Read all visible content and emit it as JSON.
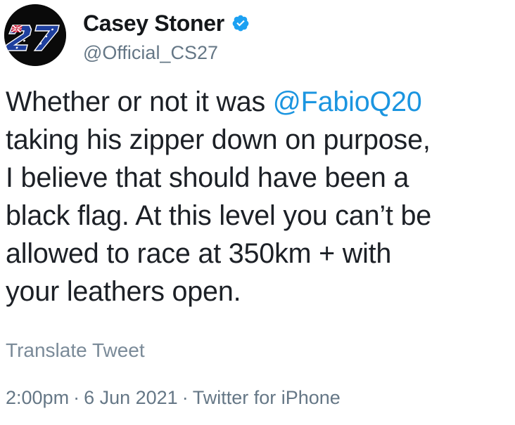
{
  "author": {
    "display_name": "Casey Stoner",
    "handle": "@Official_CS27",
    "avatar_text": "27",
    "verified_icon": "verified-badge-icon"
  },
  "tweet": {
    "line1_pre": "Whether or not it was ",
    "mention": "@FabioQ20",
    "line2": "taking his zipper down on purpose,",
    "line3": "I believe that should have been a",
    "line4": "black flag. At this level you can’t be",
    "line5": "allowed to race at 350km + with",
    "line6": "your leathers open."
  },
  "translate_label": "Translate Tweet",
  "meta": {
    "time": "2:00pm",
    "separator": "·",
    "date": "6 Jun 2021",
    "source": "Twitter for iPhone"
  },
  "colors": {
    "mention": "#1b95e0",
    "verified": "#1da1f2",
    "secondary_text": "#657786"
  }
}
